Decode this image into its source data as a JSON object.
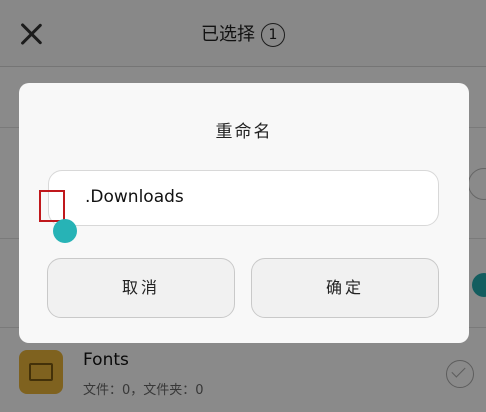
{
  "header": {
    "title": "已选择",
    "count": "1"
  },
  "dialog": {
    "title": "重命名",
    "input_value": ".Downloads",
    "cancel_label": "取消",
    "confirm_label": "确定"
  },
  "list": {
    "items": [
      {
        "name": "Fonts",
        "meta": "文件：0，文件夹：0"
      }
    ]
  },
  "colors": {
    "accent": "#27b3b6",
    "highlight_box": "#c0181c",
    "folder": "#e7b33a"
  }
}
